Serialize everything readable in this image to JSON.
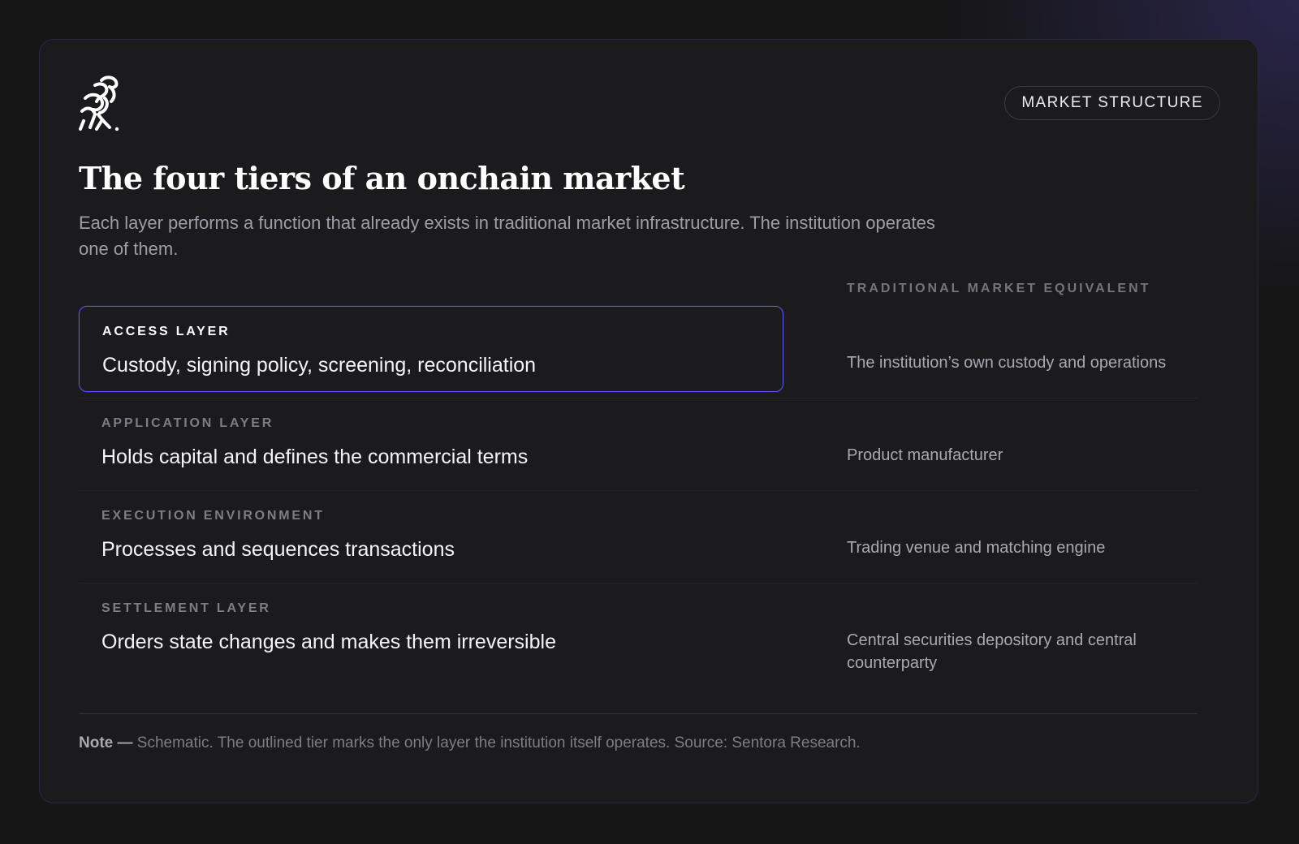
{
  "header": {
    "logo_icon": "rearing-horse-logo-icon",
    "badge": "MARKET STRUCTURE",
    "title": "The four tiers of an onchain market",
    "subtitle": "Each layer performs a function that already exists in traditional market infrastructure. The institution operates one of them."
  },
  "table": {
    "equivalent_header": "TRADITIONAL MARKET EQUIVALENT",
    "tiers": [
      {
        "label": "ACCESS LAYER",
        "description": "Custody, signing policy, screening, reconciliation",
        "equivalent": "The institution’s own custody and operations",
        "highlighted": true
      },
      {
        "label": "APPLICATION LAYER",
        "description": "Holds capital and defines the commercial terms",
        "equivalent": "Product manufacturer",
        "highlighted": false
      },
      {
        "label": "EXECUTION ENVIRONMENT",
        "description": "Processes and sequences transactions",
        "equivalent": "Trading venue and matching engine",
        "highlighted": false
      },
      {
        "label": "SETTLEMENT LAYER",
        "description": "Orders state changes and makes them irreversible",
        "equivalent": "Central securities depository and central counterparty",
        "highlighted": false
      }
    ]
  },
  "footer": {
    "note_label": "Note —",
    "note_text": " Schematic. The outlined tier marks the only layer the institution itself operates. Source: Sentora Research."
  },
  "colors": {
    "background": "#161617",
    "card": "#1b1b1d",
    "highlight_border": "#5b55f2",
    "muted_text": "#9d9da6"
  }
}
